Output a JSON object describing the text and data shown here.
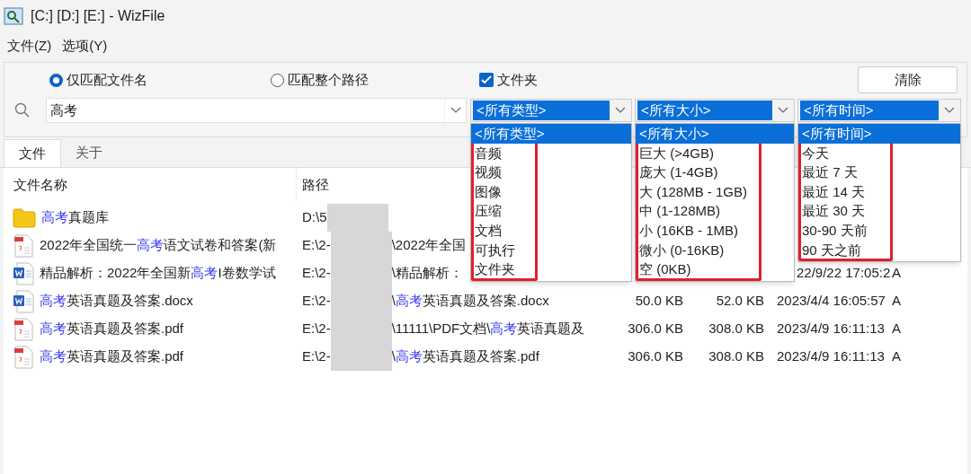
{
  "window": {
    "title": "[C:] [D:] [E:]  - WizFile"
  },
  "menu": [
    "文件(Z)",
    "选项(Y)"
  ],
  "options": {
    "radios": [
      {
        "label": "仅匹配文件名",
        "selected": true
      },
      {
        "label": "匹配整个路径",
        "selected": false
      }
    ],
    "folder_checkbox": {
      "label": "文件夹",
      "checked": true
    },
    "clear_button": "清除"
  },
  "search": {
    "value": "高考"
  },
  "filters": [
    {
      "value": "<所有类型>",
      "annotated": true,
      "options": [
        {
          "label": "<所有类型>",
          "selected": true
        },
        {
          "label": "音频",
          "selected": false
        },
        {
          "label": "视频",
          "selected": false
        },
        {
          "label": "图像",
          "selected": false
        },
        {
          "label": "压缩",
          "selected": false
        },
        {
          "label": "文档",
          "selected": false
        },
        {
          "label": "可执行",
          "selected": false
        },
        {
          "label": "文件夹",
          "selected": false
        }
      ]
    },
    {
      "value": "<所有大小>",
      "annotated": true,
      "options": [
        {
          "label": "<所有大小>",
          "selected": true
        },
        {
          "label": "巨大 (>4GB)",
          "selected": false
        },
        {
          "label": "庞大 (1-4GB)",
          "selected": false
        },
        {
          "label": "大 (128MB - 1GB)",
          "selected": false
        },
        {
          "label": "中 (1-128MB)",
          "selected": false
        },
        {
          "label": "小 (16KB - 1MB)",
          "selected": false
        },
        {
          "label": "微小 (0-16KB)",
          "selected": false
        },
        {
          "label": "空 (0KB)",
          "selected": false
        }
      ]
    },
    {
      "value": "<所有时间>",
      "annotated": true,
      "options": [
        {
          "label": "<所有时间>",
          "selected": true
        },
        {
          "label": "今天",
          "selected": false
        },
        {
          "label": "最近 7 天",
          "selected": false
        },
        {
          "label": "最近 14 天",
          "selected": false
        },
        {
          "label": "最近 30 天",
          "selected": false
        },
        {
          "label": "30-90 天前",
          "selected": false
        },
        {
          "label": "90 天之前",
          "selected": false
        }
      ]
    }
  ],
  "tabs": [
    {
      "label": "文件",
      "selected": true
    },
    {
      "label": "关于",
      "selected": false
    }
  ],
  "table": {
    "columns": [
      "文件名称",
      "路径"
    ],
    "rows": [
      {
        "kind": "folder",
        "name": [
          {
            "text": "高考",
            "hit": true
          },
          {
            "text": "真题库",
            "hit": false
          }
        ],
        "path_start": "D:\\5",
        "path_end": []
      },
      {
        "kind": "pdf",
        "name": [
          {
            "text": "2022年全国统一",
            "hit": false
          },
          {
            "text": "高考",
            "hit": true
          },
          {
            "text": "语文试卷和答案(新",
            "hit": false
          }
        ],
        "path_start": "E:\\2-",
        "path_end": [
          {
            "text": "\\2022年全国",
            "hit": false
          }
        ]
      },
      {
        "kind": "word",
        "name": [
          {
            "text": "精品解析：2022年全国新",
            "hit": false
          },
          {
            "text": "高考",
            "hit": true
          },
          {
            "text": "I卷数学试",
            "hit": false
          }
        ],
        "path_start": "E:\\2-",
        "path_end": [
          {
            "text": "\\精品解析：",
            "hit": false
          }
        ],
        "modified": "22/9/22 17:05:2",
        "attributes": "A"
      },
      {
        "kind": "word",
        "name": [
          {
            "text": "高考",
            "hit": true
          },
          {
            "text": "英语真题及答案.docx",
            "hit": false
          }
        ],
        "path_start": "E:\\2-",
        "path_end": [
          {
            "text": "\\",
            "hit": false
          },
          {
            "text": "高考",
            "hit": true
          },
          {
            "text": "英语真题及答案.docx",
            "hit": false
          }
        ],
        "size": "50.0 KB",
        "allocated": "52.0 KB",
        "modified": "2023/4/4 16:05:57",
        "attributes": "A"
      },
      {
        "kind": "pdf",
        "name": [
          {
            "text": "高考",
            "hit": true
          },
          {
            "text": "英语真题及答案.pdf",
            "hit": false
          }
        ],
        "path_start": "E:\\2-",
        "path_end": [
          {
            "text": "\\11111\\PDF文档\\",
            "hit": false
          },
          {
            "text": "高考",
            "hit": true
          },
          {
            "text": "英语真题及",
            "hit": false
          }
        ],
        "size": "306.0 KB",
        "allocated": "308.0 KB",
        "modified": "2023/4/9 16:11:13",
        "attributes": "A"
      },
      {
        "kind": "pdf",
        "name": [
          {
            "text": "高考",
            "hit": true
          },
          {
            "text": "英语真题及答案.pdf",
            "hit": false
          }
        ],
        "path_start": "E:\\2-",
        "path_end": [
          {
            "text": "\\",
            "hit": false
          },
          {
            "text": "高考",
            "hit": true
          },
          {
            "text": "英语真题及答案.pdf",
            "hit": false
          }
        ],
        "size": "306.0 KB",
        "allocated": "308.0 KB",
        "modified": "2023/4/9 16:11:13",
        "attributes": "A"
      }
    ]
  }
}
